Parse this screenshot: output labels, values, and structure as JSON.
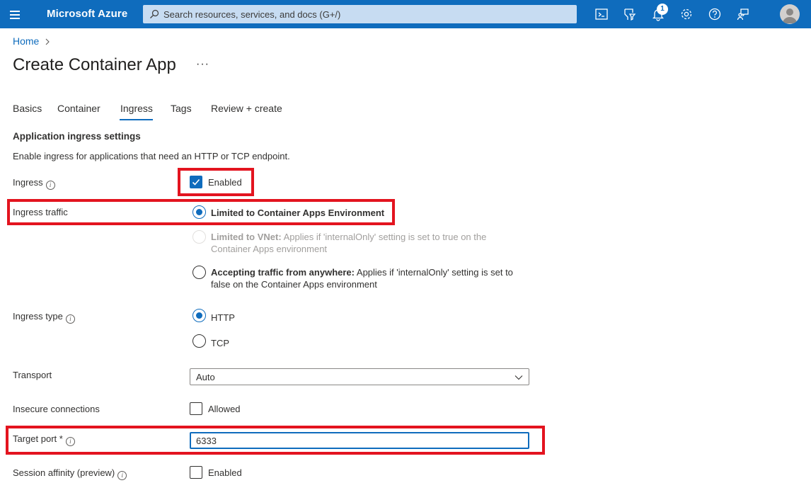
{
  "topbar": {
    "brand": "Microsoft Azure",
    "search_placeholder": "Search resources, services, and docs (G+/)",
    "notification_count": "1",
    "icons": [
      "menu-icon",
      "cloud-shell-icon",
      "directory-filter-icon",
      "notifications-icon",
      "settings-icon",
      "help-icon",
      "feedback-icon",
      "avatar"
    ]
  },
  "breadcrumb": {
    "home": "Home"
  },
  "page": {
    "title": "Create Container App",
    "more": "···"
  },
  "tabs": [
    {
      "label": "Basics"
    },
    {
      "label": "Container"
    },
    {
      "label": "Ingress",
      "active": true
    },
    {
      "label": "Tags"
    },
    {
      "label": "Review + create"
    }
  ],
  "section": {
    "title": "Application ingress settings",
    "description": "Enable ingress for applications that need an HTTP or TCP endpoint."
  },
  "form": {
    "ingress": {
      "label": "Ingress",
      "option": "Enabled",
      "checked": true
    },
    "ingress_traffic": {
      "label": "Ingress traffic",
      "options": [
        {
          "bold": "Limited to Container Apps Environment",
          "rest": "",
          "rest2": "",
          "selected": true,
          "disabled": false
        },
        {
          "bold": "Limited to VNet:",
          "rest": " Applies if 'internalOnly' setting is set to true on the",
          "rest2": "Container Apps environment",
          "selected": false,
          "disabled": true
        },
        {
          "bold": "Accepting traffic from anywhere:",
          "rest": " Applies if 'internalOnly' setting is set to",
          "rest2": "false on the Container Apps environment",
          "selected": false,
          "disabled": false
        }
      ]
    },
    "ingress_type": {
      "label": "Ingress type",
      "options": [
        {
          "label": "HTTP",
          "selected": true
        },
        {
          "label": "TCP",
          "selected": false
        }
      ]
    },
    "transport": {
      "label": "Transport",
      "value": "Auto"
    },
    "insecure": {
      "label": "Insecure connections",
      "option": "Allowed",
      "checked": false
    },
    "target_port": {
      "label": "Target port",
      "required": "*",
      "value": "6333"
    },
    "session_affinity": {
      "label": "Session affinity (preview)",
      "option": "Enabled",
      "checked": false
    }
  },
  "colors": {
    "accent": "#0f6cbd",
    "highlight": "#e3141f",
    "topbar": "#0f6cbd"
  }
}
